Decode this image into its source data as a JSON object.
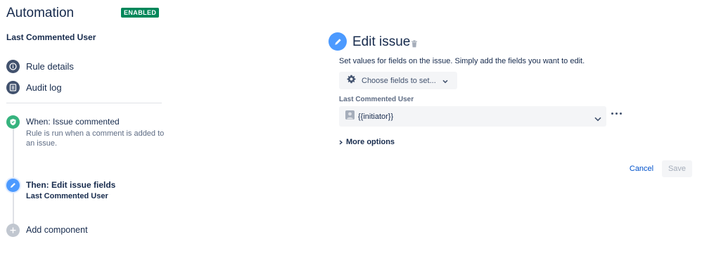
{
  "header": {
    "title": "Automation",
    "status": "ENABLED",
    "status_color": "#00875a",
    "rule_name": "Last Commented User"
  },
  "sidebar": {
    "nav": [
      {
        "label": "Rule details",
        "icon": "info-icon"
      },
      {
        "label": "Audit log",
        "icon": "list-icon"
      }
    ],
    "steps": {
      "trigger": {
        "title": "When: Issue commented",
        "description": "Rule is run when a comment is added to an issue.",
        "icon": "shield-icon",
        "color": "#36b37e"
      },
      "action": {
        "title": "Then: Edit issue fields",
        "subtitle": "Last Commented User",
        "icon": "pencil-icon",
        "color": "#4c9aff"
      },
      "add": {
        "label": "Add component",
        "icon": "plus-icon"
      }
    }
  },
  "panel": {
    "title": "Edit issue",
    "description": "Set values for fields on the issue. Simply add the fields you want to edit.",
    "choose_fields_label": "Choose fields to set...",
    "field": {
      "label": "Last Commented User",
      "value": "{{initiator}}"
    },
    "more_options_label": "More options",
    "cancel_label": "Cancel",
    "save_label": "Save"
  }
}
